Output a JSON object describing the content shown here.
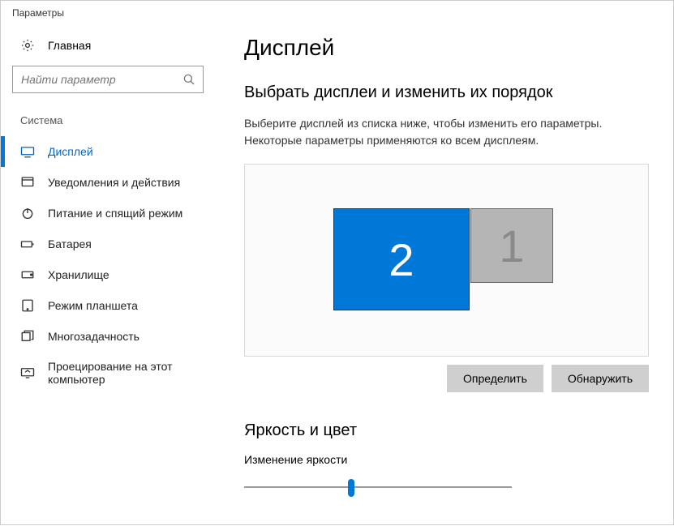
{
  "window": {
    "title": "Параметры"
  },
  "sidebar": {
    "home_label": "Главная",
    "search_placeholder": "Найти параметр",
    "group_label": "Система",
    "items": [
      {
        "label": "Дисплей"
      },
      {
        "label": "Уведомления и действия"
      },
      {
        "label": "Питание и спящий режим"
      },
      {
        "label": "Батарея"
      },
      {
        "label": "Хранилище"
      },
      {
        "label": "Режим планшета"
      },
      {
        "label": "Многозадачность"
      },
      {
        "label": "Проецирование на этот компьютер"
      }
    ]
  },
  "main": {
    "page_title": "Дисплей",
    "arrange_heading": "Выбрать дисплеи и изменить их порядок",
    "arrange_desc": "Выберите дисплей из списка ниже, чтобы изменить его параметры. Некоторые параметры применяются ко всем дисплеям.",
    "monitors": {
      "selected": "2",
      "other": "1"
    },
    "btn_identify": "Определить",
    "btn_detect": "Обнаружить",
    "brightness_heading": "Яркость и цвет",
    "brightness_label": "Изменение яркости",
    "brightness_percent": 40
  }
}
